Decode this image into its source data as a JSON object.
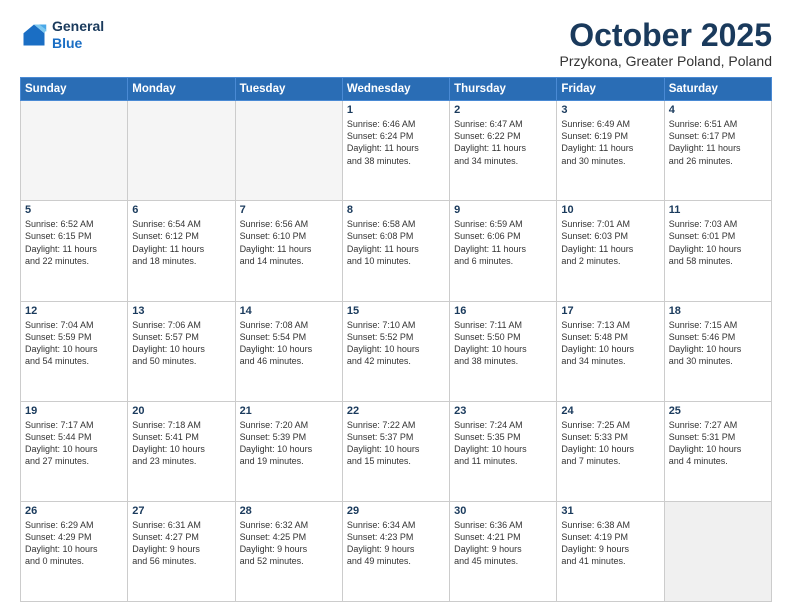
{
  "header": {
    "logo_line1": "General",
    "logo_line2": "Blue",
    "month_year": "October 2025",
    "location": "Przykona, Greater Poland, Poland"
  },
  "weekdays": [
    "Sunday",
    "Monday",
    "Tuesday",
    "Wednesday",
    "Thursday",
    "Friday",
    "Saturday"
  ],
  "weeks": [
    [
      {
        "day": "",
        "info": ""
      },
      {
        "day": "",
        "info": ""
      },
      {
        "day": "",
        "info": ""
      },
      {
        "day": "1",
        "info": "Sunrise: 6:46 AM\nSunset: 6:24 PM\nDaylight: 11 hours\nand 38 minutes."
      },
      {
        "day": "2",
        "info": "Sunrise: 6:47 AM\nSunset: 6:22 PM\nDaylight: 11 hours\nand 34 minutes."
      },
      {
        "day": "3",
        "info": "Sunrise: 6:49 AM\nSunset: 6:19 PM\nDaylight: 11 hours\nand 30 minutes."
      },
      {
        "day": "4",
        "info": "Sunrise: 6:51 AM\nSunset: 6:17 PM\nDaylight: 11 hours\nand 26 minutes."
      }
    ],
    [
      {
        "day": "5",
        "info": "Sunrise: 6:52 AM\nSunset: 6:15 PM\nDaylight: 11 hours\nand 22 minutes."
      },
      {
        "day": "6",
        "info": "Sunrise: 6:54 AM\nSunset: 6:12 PM\nDaylight: 11 hours\nand 18 minutes."
      },
      {
        "day": "7",
        "info": "Sunrise: 6:56 AM\nSunset: 6:10 PM\nDaylight: 11 hours\nand 14 minutes."
      },
      {
        "day": "8",
        "info": "Sunrise: 6:58 AM\nSunset: 6:08 PM\nDaylight: 11 hours\nand 10 minutes."
      },
      {
        "day": "9",
        "info": "Sunrise: 6:59 AM\nSunset: 6:06 PM\nDaylight: 11 hours\nand 6 minutes."
      },
      {
        "day": "10",
        "info": "Sunrise: 7:01 AM\nSunset: 6:03 PM\nDaylight: 11 hours\nand 2 minutes."
      },
      {
        "day": "11",
        "info": "Sunrise: 7:03 AM\nSunset: 6:01 PM\nDaylight: 10 hours\nand 58 minutes."
      }
    ],
    [
      {
        "day": "12",
        "info": "Sunrise: 7:04 AM\nSunset: 5:59 PM\nDaylight: 10 hours\nand 54 minutes."
      },
      {
        "day": "13",
        "info": "Sunrise: 7:06 AM\nSunset: 5:57 PM\nDaylight: 10 hours\nand 50 minutes."
      },
      {
        "day": "14",
        "info": "Sunrise: 7:08 AM\nSunset: 5:54 PM\nDaylight: 10 hours\nand 46 minutes."
      },
      {
        "day": "15",
        "info": "Sunrise: 7:10 AM\nSunset: 5:52 PM\nDaylight: 10 hours\nand 42 minutes."
      },
      {
        "day": "16",
        "info": "Sunrise: 7:11 AM\nSunset: 5:50 PM\nDaylight: 10 hours\nand 38 minutes."
      },
      {
        "day": "17",
        "info": "Sunrise: 7:13 AM\nSunset: 5:48 PM\nDaylight: 10 hours\nand 34 minutes."
      },
      {
        "day": "18",
        "info": "Sunrise: 7:15 AM\nSunset: 5:46 PM\nDaylight: 10 hours\nand 30 minutes."
      }
    ],
    [
      {
        "day": "19",
        "info": "Sunrise: 7:17 AM\nSunset: 5:44 PM\nDaylight: 10 hours\nand 27 minutes."
      },
      {
        "day": "20",
        "info": "Sunrise: 7:18 AM\nSunset: 5:41 PM\nDaylight: 10 hours\nand 23 minutes."
      },
      {
        "day": "21",
        "info": "Sunrise: 7:20 AM\nSunset: 5:39 PM\nDaylight: 10 hours\nand 19 minutes."
      },
      {
        "day": "22",
        "info": "Sunrise: 7:22 AM\nSunset: 5:37 PM\nDaylight: 10 hours\nand 15 minutes."
      },
      {
        "day": "23",
        "info": "Sunrise: 7:24 AM\nSunset: 5:35 PM\nDaylight: 10 hours\nand 11 minutes."
      },
      {
        "day": "24",
        "info": "Sunrise: 7:25 AM\nSunset: 5:33 PM\nDaylight: 10 hours\nand 7 minutes."
      },
      {
        "day": "25",
        "info": "Sunrise: 7:27 AM\nSunset: 5:31 PM\nDaylight: 10 hours\nand 4 minutes."
      }
    ],
    [
      {
        "day": "26",
        "info": "Sunrise: 6:29 AM\nSunset: 4:29 PM\nDaylight: 10 hours\nand 0 minutes."
      },
      {
        "day": "27",
        "info": "Sunrise: 6:31 AM\nSunset: 4:27 PM\nDaylight: 9 hours\nand 56 minutes."
      },
      {
        "day": "28",
        "info": "Sunrise: 6:32 AM\nSunset: 4:25 PM\nDaylight: 9 hours\nand 52 minutes."
      },
      {
        "day": "29",
        "info": "Sunrise: 6:34 AM\nSunset: 4:23 PM\nDaylight: 9 hours\nand 49 minutes."
      },
      {
        "day": "30",
        "info": "Sunrise: 6:36 AM\nSunset: 4:21 PM\nDaylight: 9 hours\nand 45 minutes."
      },
      {
        "day": "31",
        "info": "Sunrise: 6:38 AM\nSunset: 4:19 PM\nDaylight: 9 hours\nand 41 minutes."
      },
      {
        "day": "",
        "info": ""
      }
    ]
  ]
}
